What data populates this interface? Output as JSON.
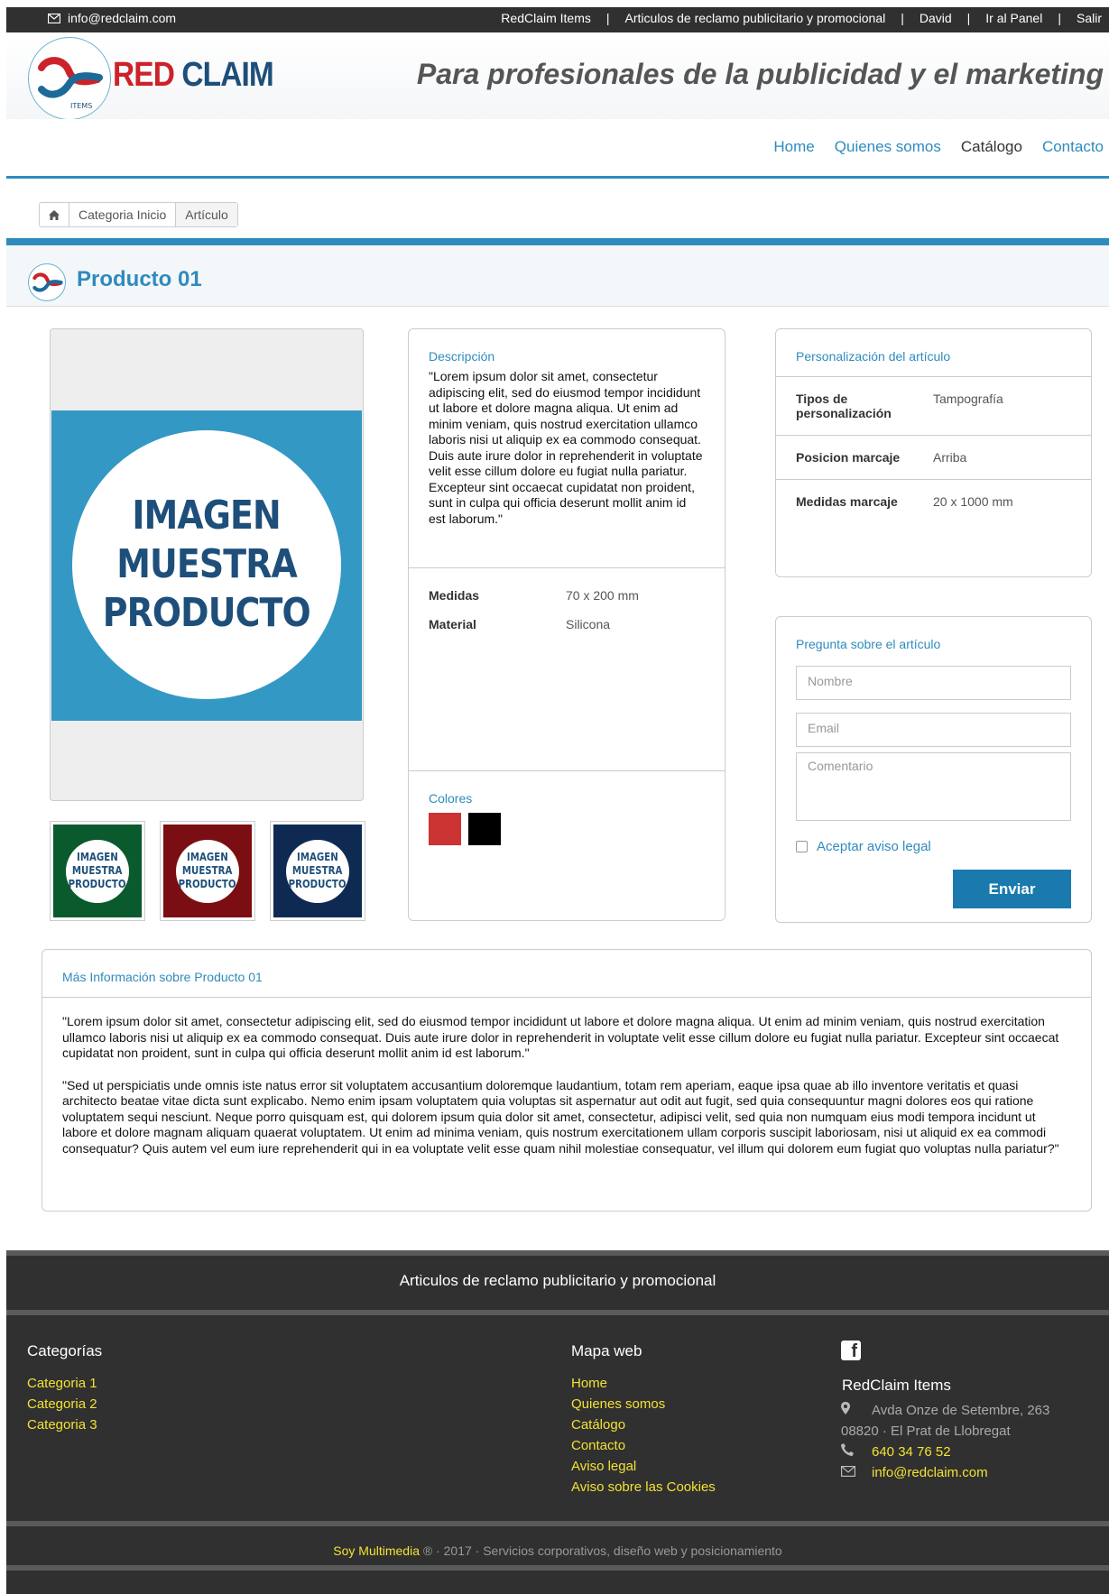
{
  "topbar": {
    "email": "info@redclaim.com",
    "links": [
      "RedClaim Items",
      "Articulos de reclamo publicitario y promocional",
      "David",
      "Ir al Panel",
      "Salir"
    ],
    "separator": "|"
  },
  "header": {
    "brand_red": "RED",
    "brand_blue": "CLAIM",
    "logo_text": "ITEMS",
    "tagline": "Para profesionales de la publicidad y el marketing"
  },
  "nav": {
    "items": [
      "Home",
      "Quienes somos",
      "Catálogo",
      "Contacto"
    ],
    "active": "Catálogo"
  },
  "breadcrumb": {
    "items": [
      "Categoria Inicio",
      "Artículo"
    ]
  },
  "product": {
    "title": "Producto 01",
    "image_text": [
      "IMAGEN",
      "MUESTRA",
      "PRODUCTO"
    ],
    "thumb_colors": [
      "#0b5a2e",
      "#7a0e12",
      "#0f2a52"
    ]
  },
  "description": {
    "heading": "Descripción",
    "text": "\"Lorem ipsum dolor sit amet, consectetur adipiscing elit, sed do eiusmod tempor incididunt ut labore et dolore magna aliqua. Ut enim ad minim veniam, quis nostrud exercitation ullamco laboris nisi ut aliquip ex ea commodo consequat. Duis aute irure dolor in reprehenderit in voluptate velit esse cillum dolore eu fugiat nulla pariatur. Excepteur sint occaecat cupidatat non proident, sunt in culpa qui officia deserunt mollit anim id est laborum.\"",
    "specs": [
      {
        "label": "Medidas",
        "value": "70 x 200 mm"
      },
      {
        "label": "Material",
        "value": "Silicona"
      }
    ],
    "colors_heading": "Colores",
    "colors": [
      "#cc3333",
      "#000000"
    ]
  },
  "personalization": {
    "heading": "Personalización del artículo",
    "rows": [
      {
        "label": "Tipos de personalización",
        "value": "Tampografía"
      },
      {
        "label": "Posicion marcaje",
        "value": "Arriba"
      },
      {
        "label": "Medidas marcaje",
        "value": "20 x 1000 mm"
      }
    ]
  },
  "question_form": {
    "heading": "Pregunta sobre el artículo",
    "name_placeholder": "Nombre",
    "email_placeholder": "Email",
    "comment_placeholder": "Comentario",
    "checkbox_label": "Aceptar aviso legal",
    "submit_label": "Enviar"
  },
  "more_info": {
    "heading": "Más Información sobre Producto 01",
    "paragraphs": [
      "\"Lorem ipsum dolor sit amet, consectetur adipiscing elit, sed do eiusmod tempor incididunt ut labore et dolore magna aliqua. Ut enim ad minim veniam, quis nostrud exercitation ullamco laboris nisi ut aliquip ex ea commodo consequat. Duis aute irure dolor in reprehenderit in voluptate velit esse cillum dolore eu fugiat nulla pariatur. Excepteur sint occaecat cupidatat non proident, sunt in culpa qui officia deserunt mollit anim id est laborum.\"",
      "\"Sed ut perspiciatis unde omnis iste natus error sit voluptatem accusantium doloremque laudantium, totam rem aperiam, eaque ipsa quae ab illo inventore veritatis et quasi architecto beatae vitae dicta sunt explicabo. Nemo enim ipsam voluptatem quia voluptas sit aspernatur aut odit aut fugit, sed quia consequuntur magni dolores eos qui ratione voluptatem sequi nesciunt. Neque porro quisquam est, qui dolorem ipsum quia dolor sit amet, consectetur, adipisci velit, sed quia non numquam eius modi tempora incidunt ut labore et dolore magnam aliquam quaerat voluptatem. Ut enim ad minima veniam, quis nostrum exercitationem ullam corporis suscipit laboriosam, nisi ut aliquid ex ea commodi consequatur? Quis autem vel eum iure reprehenderit qui in ea voluptate velit esse quam nihil molestiae consequatur, vel illum qui dolorem eum fugiat quo voluptas nulla pariatur?\""
    ]
  },
  "footer": {
    "title": "Articulos de reclamo publicitario y promocional",
    "categories_heading": "Categorías",
    "categories": [
      "Categoria 1",
      "Categoria 2",
      "Categoria 3"
    ],
    "sitemap_heading": "Mapa web",
    "sitemap": [
      "Home",
      "Quienes somos",
      "Catálogo",
      "Contacto",
      "Aviso legal",
      "Aviso sobre las Cookies"
    ],
    "company": "RedClaim Items",
    "address_line1": "Avda Onze de Setembre, 263",
    "address_line2": "08820 · El Prat de Llobregat",
    "phone": "640 34 76 52",
    "email": "info@redclaim.com",
    "credit_brand": "Soy Multimedia",
    "credit_rest": "® · 2017 · Servicios corporativos, diseño web y posicionamiento"
  }
}
